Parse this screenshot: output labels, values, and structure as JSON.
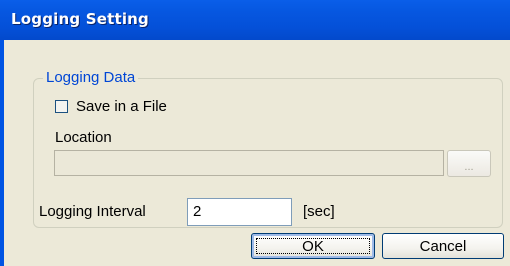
{
  "window": {
    "title": "Logging Setting"
  },
  "logging_data": {
    "group_label": "Logging Data",
    "save_in_file_label": "Save in a File",
    "save_in_file_checked": false,
    "location_label": "Location",
    "location_value": "",
    "browse_label": "..."
  },
  "interval": {
    "label": "Logging Interval",
    "value": "2",
    "unit": "[sec]"
  },
  "buttons": {
    "ok_label": "OK",
    "cancel_label": "Cancel"
  },
  "colors": {
    "titlebar": "#0450d8",
    "client_background": "#ece9d8",
    "group_label": "#0046d5"
  }
}
